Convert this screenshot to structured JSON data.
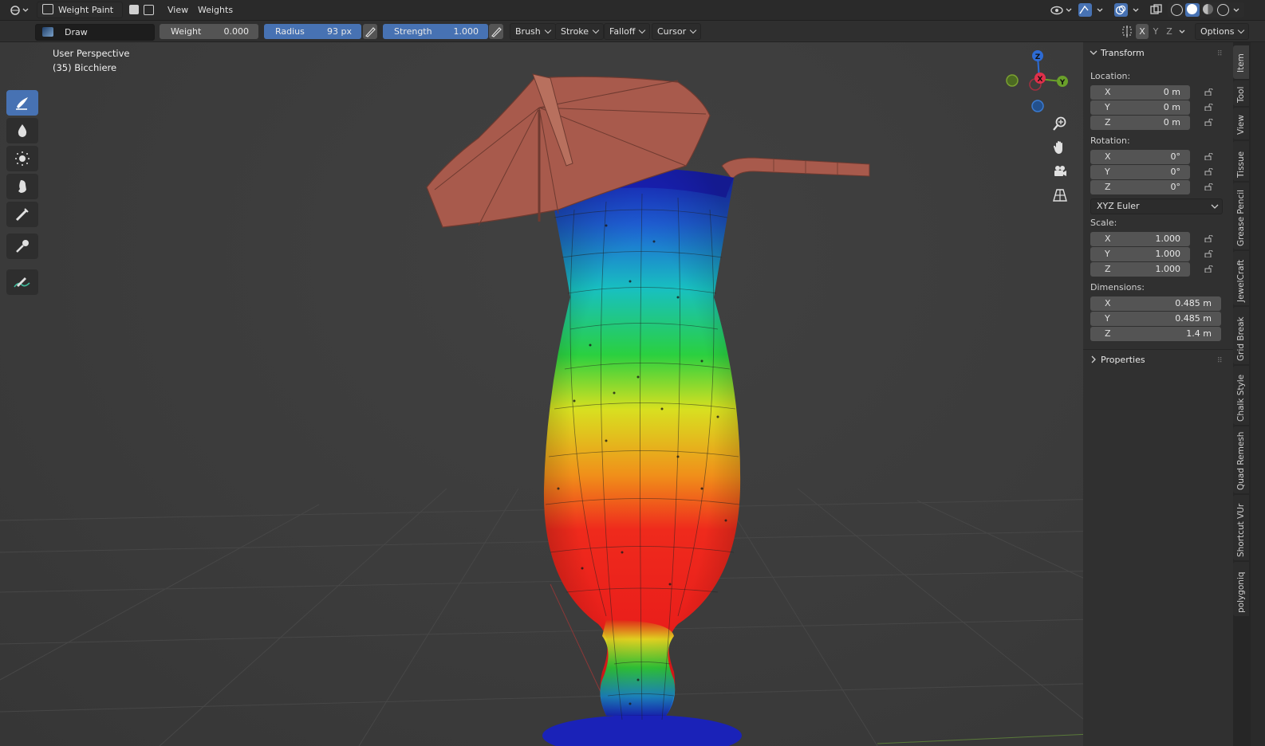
{
  "header": {
    "mode": "Weight Paint",
    "menus": [
      "View",
      "Weights"
    ],
    "tool_name": "Draw",
    "weight": {
      "label": "Weight",
      "value": "0.000"
    },
    "radius": {
      "label": "Radius",
      "value": "93 px"
    },
    "strength": {
      "label": "Strength",
      "value": "1.000"
    },
    "dropdowns": [
      "Brush",
      "Stroke",
      "Falloff",
      "Cursor"
    ],
    "axes": [
      "X",
      "Y",
      "Z"
    ],
    "options": "Options"
  },
  "viewport": {
    "perspective": "User Perspective",
    "object": "(35) Bicchiere",
    "gizmo": {
      "z": "Z",
      "x": "X",
      "y": "Y"
    }
  },
  "npanel": {
    "transform_title": "Transform",
    "location_label": "Location:",
    "location": [
      {
        "axis": "X",
        "value": "0 m"
      },
      {
        "axis": "Y",
        "value": "0 m"
      },
      {
        "axis": "Z",
        "value": "0 m"
      }
    ],
    "rotation_label": "Rotation:",
    "rotation": [
      {
        "axis": "X",
        "value": "0°"
      },
      {
        "axis": "Y",
        "value": "0°"
      },
      {
        "axis": "Z",
        "value": "0°"
      }
    ],
    "rotation_mode": "XYZ Euler",
    "scale_label": "Scale:",
    "scale": [
      {
        "axis": "X",
        "value": "1.000"
      },
      {
        "axis": "Y",
        "value": "1.000"
      },
      {
        "axis": "Z",
        "value": "1.000"
      }
    ],
    "dimensions_label": "Dimensions:",
    "dimensions": [
      {
        "axis": "X",
        "value": "0.485 m"
      },
      {
        "axis": "Y",
        "value": "0.485 m"
      },
      {
        "axis": "Z",
        "value": "1.4 m"
      }
    ],
    "properties_title": "Properties"
  },
  "tabs": [
    "Item",
    "Tool",
    "View",
    "Tissue",
    "Grease Pencil",
    "JewelCraft",
    "Grid Break",
    "Chalk Style",
    "Quad Remesh",
    "Shortcut VUr",
    "polygoniq"
  ]
}
